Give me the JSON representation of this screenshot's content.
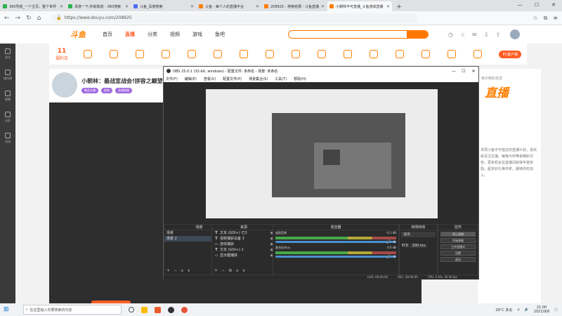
{
  "tabs": [
    {
      "label": "360导航_一个主页，整个世界",
      "color": "#2fb14d",
      "active": false
    },
    {
      "label": "百度一下,你就知道 - 360搜索",
      "color": "#2fb14d",
      "active": false
    },
    {
      "label": "斗鱼_百度搜索",
      "color": "#4e6ef2",
      "active": false
    },
    {
      "label": "斗鱼 - 每个人的直播平台",
      "color": "#ff7f00",
      "active": false
    },
    {
      "label": "208925 - 搜索结果 - 斗鱼直播",
      "color": "#ff7f00",
      "active": false
    },
    {
      "label": "小朝林不可直播_斗鱼游戏直播",
      "color": "#ff7f00",
      "active": true
    }
  ],
  "browser": {
    "new_tab": "+",
    "url": "https://www.douyu.com/208925",
    "min": "—",
    "max": "☐",
    "close": "✕"
  },
  "douyu": {
    "logo": "斗鱼",
    "nav": [
      "首页",
      "直播",
      "分类",
      "视频",
      "游戏",
      "鱼吧"
    ],
    "date_label": "11",
    "date_sub": "福利日",
    "pc_button": "PC客户端",
    "sidebar": [
      "关注",
      "排行榜",
      "视频",
      "分区",
      "活动"
    ],
    "streamer_title": "小朝林：最战宣战会!拼容之巅望...",
    "tags": [
      "精品主播",
      "原神",
      "英雄联盟"
    ],
    "right_title": "每日精彩放送",
    "right_banner": "直播",
    "desc": "本周斗鱼不可错过的直播计划，喜欢就关注主播。每晚为你带来精彩内容，更有机会在直播间获得丰富奖励，超多好礼等你拿。期待你的加入。"
  },
  "obs": {
    "title": "OBS 25.0.1 (32-bit, windows) - 配置文件: 未命名 - 场景: 未命名",
    "menu": [
      "文件(F)",
      "编辑(E)",
      "查看(V)",
      "配置文件(P)",
      "场景集合(S)",
      "工具(T)",
      "帮助(H)"
    ],
    "docks": {
      "scenes": "场景",
      "sources": "来源",
      "mixer": "混音器",
      "transitions": "转场特效",
      "controls": "控件"
    },
    "scenes": [
      "场景",
      "场景 2"
    ],
    "sources": [
      {
        "icon": "T",
        "name": "文本 (GDI+) 已3"
      },
      {
        "icon": "T",
        "name": "视频捕获设备 3"
      },
      {
        "icon": "▭",
        "name": "游戏捕获"
      },
      {
        "icon": "T",
        "name": "文本 (GDI+) 2"
      },
      {
        "icon": "▭",
        "name": "显示器捕获"
      }
    ],
    "mixer": [
      {
        "name": "桌面音频",
        "level": "-0.1 dB"
      },
      {
        "name": "麦克风/Aux",
        "level": "0.0 dB"
      }
    ],
    "transition": "淡出",
    "duration_label": "时长",
    "duration": "300 ms",
    "controls": [
      "停止直播",
      "开始录制",
      "工作室模式",
      "设置",
      "退出"
    ],
    "status": [
      "LIVE: 00:00:00",
      "REC: 00:00:00",
      "CPU: 2.9%, 30.00 fps"
    ]
  },
  "taskbar": {
    "search_placeholder": "在这里输入你要搜索的内容",
    "weather": "26°C 多云",
    "time": "21:00",
    "date": "2021/9/6"
  },
  "colors": {
    "accent": "#ff7f00",
    "obs_bg": "#2b2b2b"
  }
}
